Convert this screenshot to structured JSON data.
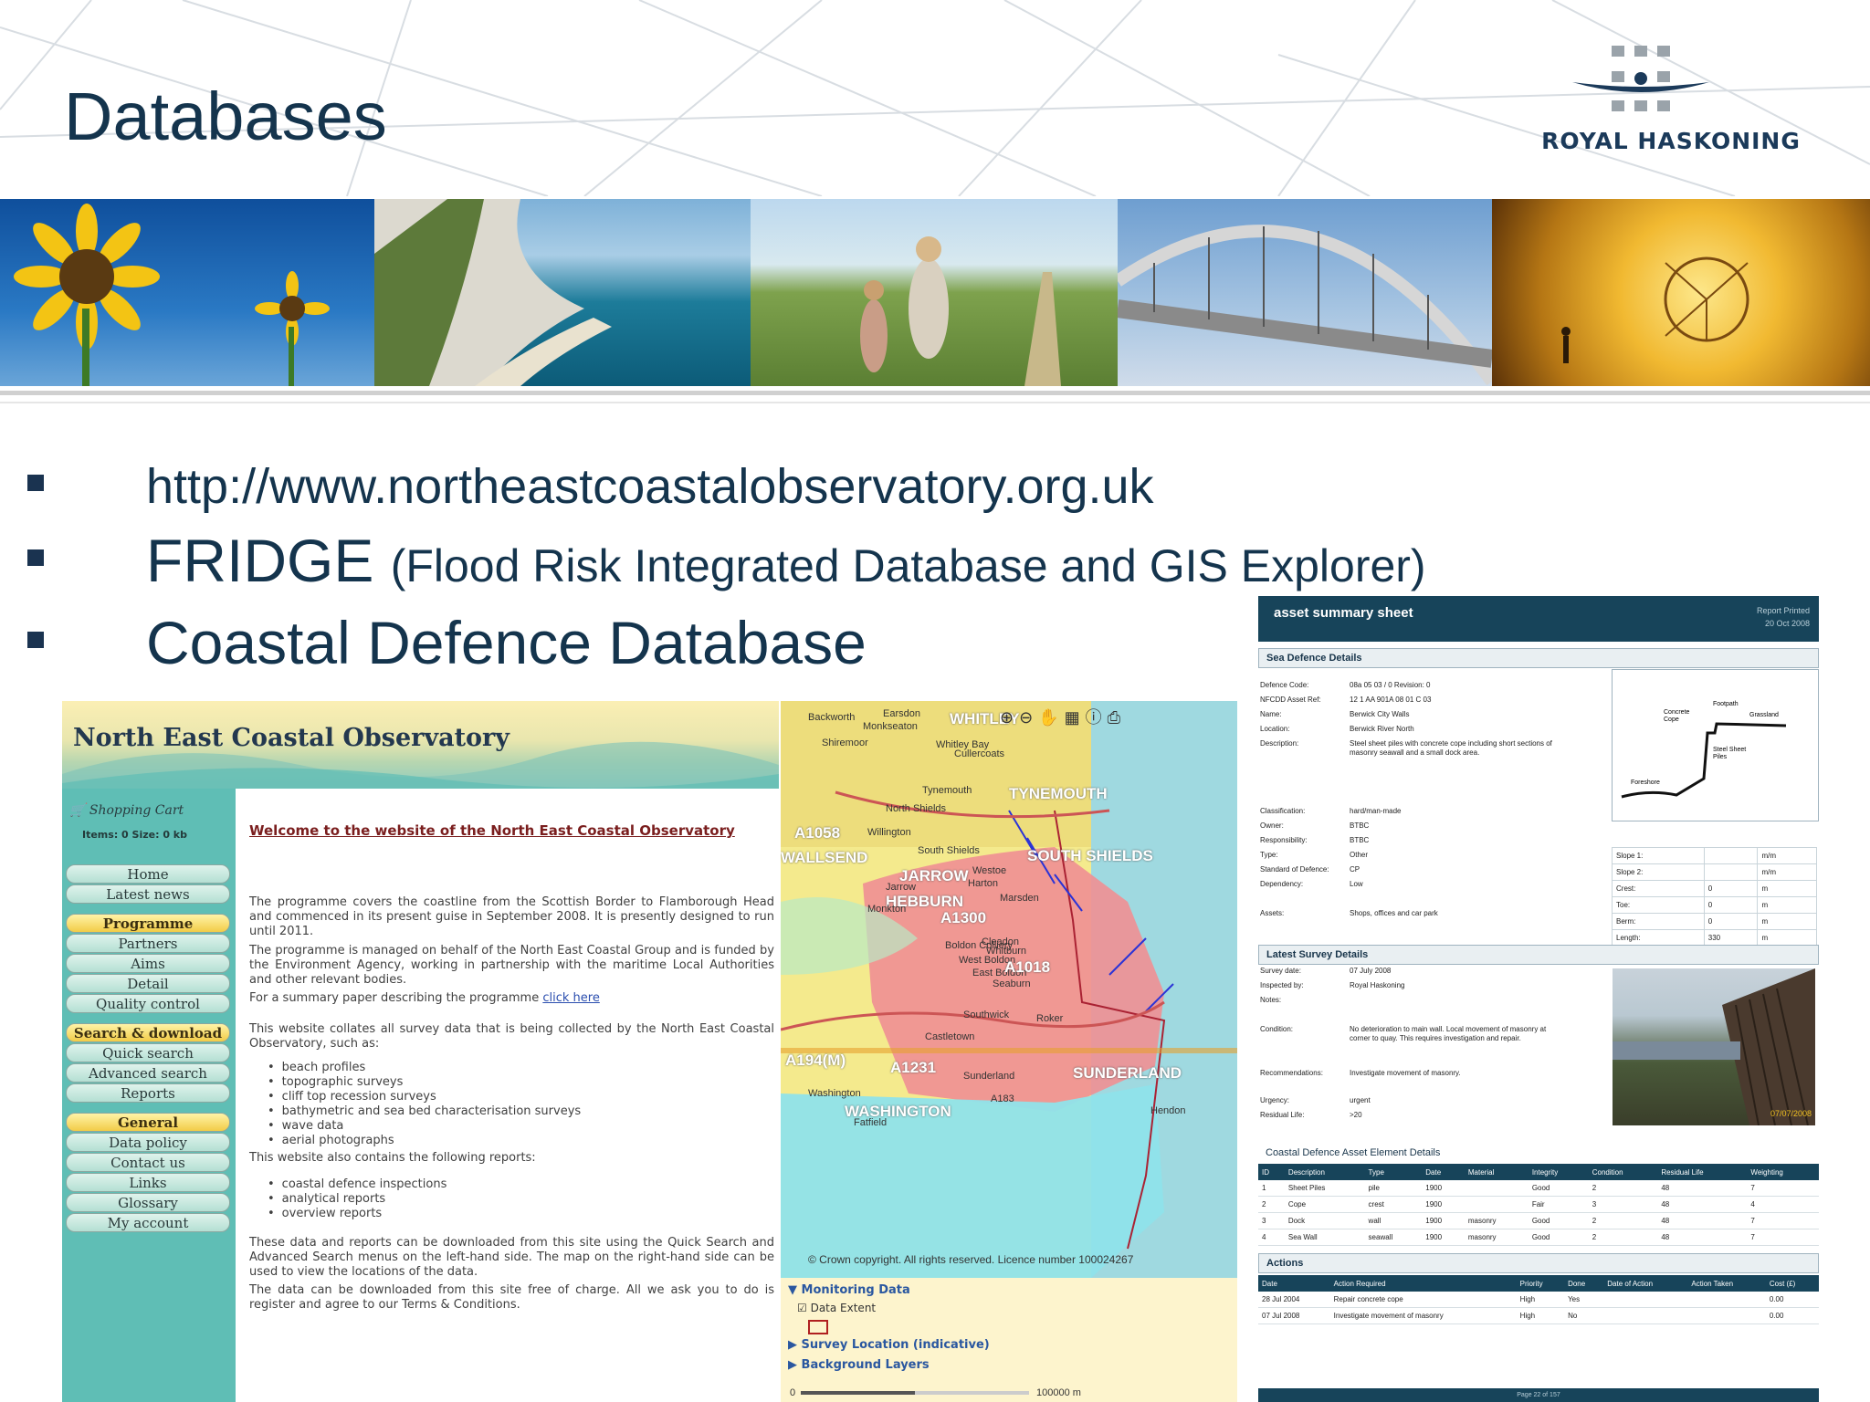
{
  "slide": {
    "title": "Databases",
    "logo_text": "ROYAL HASKONING",
    "bullets": [
      {
        "text": "http://www.northeastcoastalobservatory.org.uk"
      },
      {
        "text": "FRIDGE",
        "small": "(Flood Risk Integrated Database and GIS Explorer)"
      },
      {
        "text": "Coastal Defence Database"
      }
    ]
  },
  "neco": {
    "title": "North East Coastal Observatory",
    "cart_label": "Shopping Cart",
    "items_label": "Items: 0    Size: 0 kb",
    "nav": [
      {
        "label": "Home",
        "header": false
      },
      {
        "label": "Latest news",
        "header": false
      },
      {
        "label": "Programme",
        "header": true
      },
      {
        "label": "Partners",
        "header": false
      },
      {
        "label": "Aims",
        "header": false
      },
      {
        "label": "Detail",
        "header": false
      },
      {
        "label": "Quality control",
        "header": false
      },
      {
        "label": "Search & download",
        "header": true
      },
      {
        "label": "Quick search",
        "header": false
      },
      {
        "label": "Advanced search",
        "header": false
      },
      {
        "label": "Reports",
        "header": false
      },
      {
        "label": "General",
        "header": true
      },
      {
        "label": "Data policy",
        "header": false
      },
      {
        "label": "Contact us",
        "header": false
      },
      {
        "label": "Links",
        "header": false
      },
      {
        "label": "Glossary",
        "header": false
      },
      {
        "label": "My account",
        "header": false
      }
    ],
    "welcome": "Welcome to the website of the North East Coastal Observatory",
    "p1": "The programme covers the coastline from the Scottish Border to Flamborough Head and commenced in its present guise in September 2008. It is presently designed to run until 2011.",
    "p2": "The programme is managed on behalf of the North East Coastal Group and is funded by the Environment Agency, working in partnership with the maritime Local Authorities and other relevant bodies.",
    "p3_before": "For a summary paper describing the programme ",
    "p3_link": "click here",
    "p4": "This website collates all survey data that is being collected by the North East Coastal Observatory, such as:",
    "list1": [
      "beach profiles",
      "topographic surveys",
      "cliff top recession surveys",
      "bathymetric and sea bed characterisation surveys",
      "wave data",
      "aerial photographs"
    ],
    "p5": "This website also contains the following reports:",
    "list2": [
      "coastal defence inspections",
      "analytical reports",
      "overview reports"
    ],
    "p6": "These data and reports can be downloaded from this site using the Quick Search and Advanced Search menus on the left-hand side. The map on the right-hand side can be used to view the locations of the data.",
    "p7": "The data can be downloaded from this site free of charge. All we ask you to do is register and agree to our Terms & Conditions."
  },
  "map": {
    "labels": [
      "Backworth",
      "Earsdon",
      "WHITLEY",
      "Monkseaton",
      "Shiremoor",
      "Whitley Bay",
      "Cullercoats",
      "Tynemouth",
      "TYNEMOUTH",
      "North Shields",
      "Willington",
      "A1058",
      "WALLSEND",
      "South Shields",
      "SOUTH SHIELDS",
      "JARROW",
      "Westoe",
      "Harton",
      "HEBBURN",
      "Jarrow",
      "Monkton",
      "A1300",
      "Cleadon",
      "Marsden",
      "Boldon Colliery",
      "West Boldon",
      "East Boldon",
      "Whitburn",
      "A1018",
      "Seaburn",
      "Roker",
      "Southwick",
      "Castletown",
      "A194(M)",
      "A1231",
      "Sunderland",
      "SUNDERLAND",
      "Washington",
      "WASHINGTON",
      "Fatfield",
      "Hendon",
      "A183"
    ],
    "copyright": "© Crown copyright. All rights reserved. Licence number 100024267",
    "panel": {
      "monitoring": "Monitoring Data",
      "extent": "Data Extent",
      "survey": "Survey Location (indicative)",
      "background": "Background Layers",
      "scale_left": "0",
      "scale_right": "100000 m"
    }
  },
  "sheet": {
    "title": "asset summary sheet",
    "report_printed": "Report Printed",
    "report_date": "20 Oct 2008",
    "section1": "Sea Defence Details",
    "details": [
      {
        "k": "Defence Code:",
        "v": "08a  05  03  /  0          Revision: 0"
      },
      {
        "k": "NFCDD Asset Ref:",
        "v": "12  1  AA  901A  08  01  C  03"
      },
      {
        "k": "Name:",
        "v": "Berwick City Walls"
      },
      {
        "k": "Location:",
        "v": "Berwick River North"
      },
      {
        "k": "Description:",
        "v": "Steel sheet piles with concrete cope including short sections of masonry seawall and a small dock area."
      }
    ],
    "details2": [
      {
        "k": "Classification:",
        "v": "hard/man-made"
      },
      {
        "k": "Owner:",
        "v": "BTBC"
      },
      {
        "k": "Responsibility:",
        "v": "BTBC"
      },
      {
        "k": "Type:",
        "v": "Other"
      },
      {
        "k": "Standard of Defence:",
        "v": "CP"
      },
      {
        "k": "Dependency:",
        "v": "Low"
      },
      {
        "k": "Assets:",
        "v": "Shops, offices and car park"
      }
    ],
    "diagram_labels": [
      "Concrete Cope",
      "Footpath",
      "Grassland",
      "Steel Sheet Piles",
      "Foreshore"
    ],
    "dims": [
      {
        "k": "Slope 1:",
        "v": "",
        "u": "m/m"
      },
      {
        "k": "Slope 2:",
        "v": "",
        "u": "m/m"
      },
      {
        "k": "Crest:",
        "v": "0",
        "u": "m"
      },
      {
        "k": "Toe:",
        "v": "0",
        "u": "m"
      },
      {
        "k": "Berm:",
        "v": "0",
        "u": "m"
      },
      {
        "k": "Length:",
        "v": "330",
        "u": "m"
      }
    ],
    "section2": "Latest Survey Details",
    "survey": [
      {
        "k": "Survey date:",
        "v": "07 July 2008"
      },
      {
        "k": "Inspected by:",
        "v": "Royal Haskoning"
      },
      {
        "k": "Notes:",
        "v": ""
      },
      {
        "k": "Condition:",
        "v": "No deterioration to main wall. Local movement of masonry at corner to quay. This requires investigation and repair."
      },
      {
        "k": "Recommendations:",
        "v": "Investigate movement of masonry."
      },
      {
        "k": "Urgency:",
        "v": "urgent"
      },
      {
        "k": "Residual Life:",
        "v": ">20"
      }
    ],
    "photo_date": "07/07/2008",
    "section3": "Coastal Defence Asset Element Details",
    "elements_header": [
      "ID",
      "Description",
      "Type",
      "Date",
      "Material",
      "Integrity",
      "Condition",
      "Residual Life",
      "Weighting"
    ],
    "elements": [
      [
        "1",
        "Sheet Piles",
        "pile",
        "1900",
        "",
        "Good",
        "2",
        "48",
        "7"
      ],
      [
        "2",
        "Cope",
        "crest",
        "1900",
        "",
        "Fair",
        "3",
        "48",
        "4"
      ],
      [
        "3",
        "Dock",
        "wall",
        "1900",
        "masonry",
        "Good",
        "2",
        "48",
        "7"
      ],
      [
        "4",
        "Sea Wall",
        "seawall",
        "1900",
        "masonry",
        "Good",
        "2",
        "48",
        "7"
      ]
    ],
    "section4": "Actions",
    "actions_header": [
      "Date",
      "Action Required",
      "Priority",
      "Done",
      "Date of Action",
      "Action Taken",
      "Cost (£)"
    ],
    "actions": [
      [
        "28 Jul 2004",
        "Repair concrete cope",
        "High",
        "Yes",
        "",
        "",
        "0.00"
      ],
      [
        "07 Jul 2008",
        "Investigate movement of masonry",
        "High",
        "No",
        "",
        "",
        "0.00"
      ]
    ],
    "footer": "Page 22 of 157"
  },
  "colors": {
    "title": "#14344d",
    "sheet_header": "#17445a",
    "neco_side": "#5fbeb5"
  }
}
